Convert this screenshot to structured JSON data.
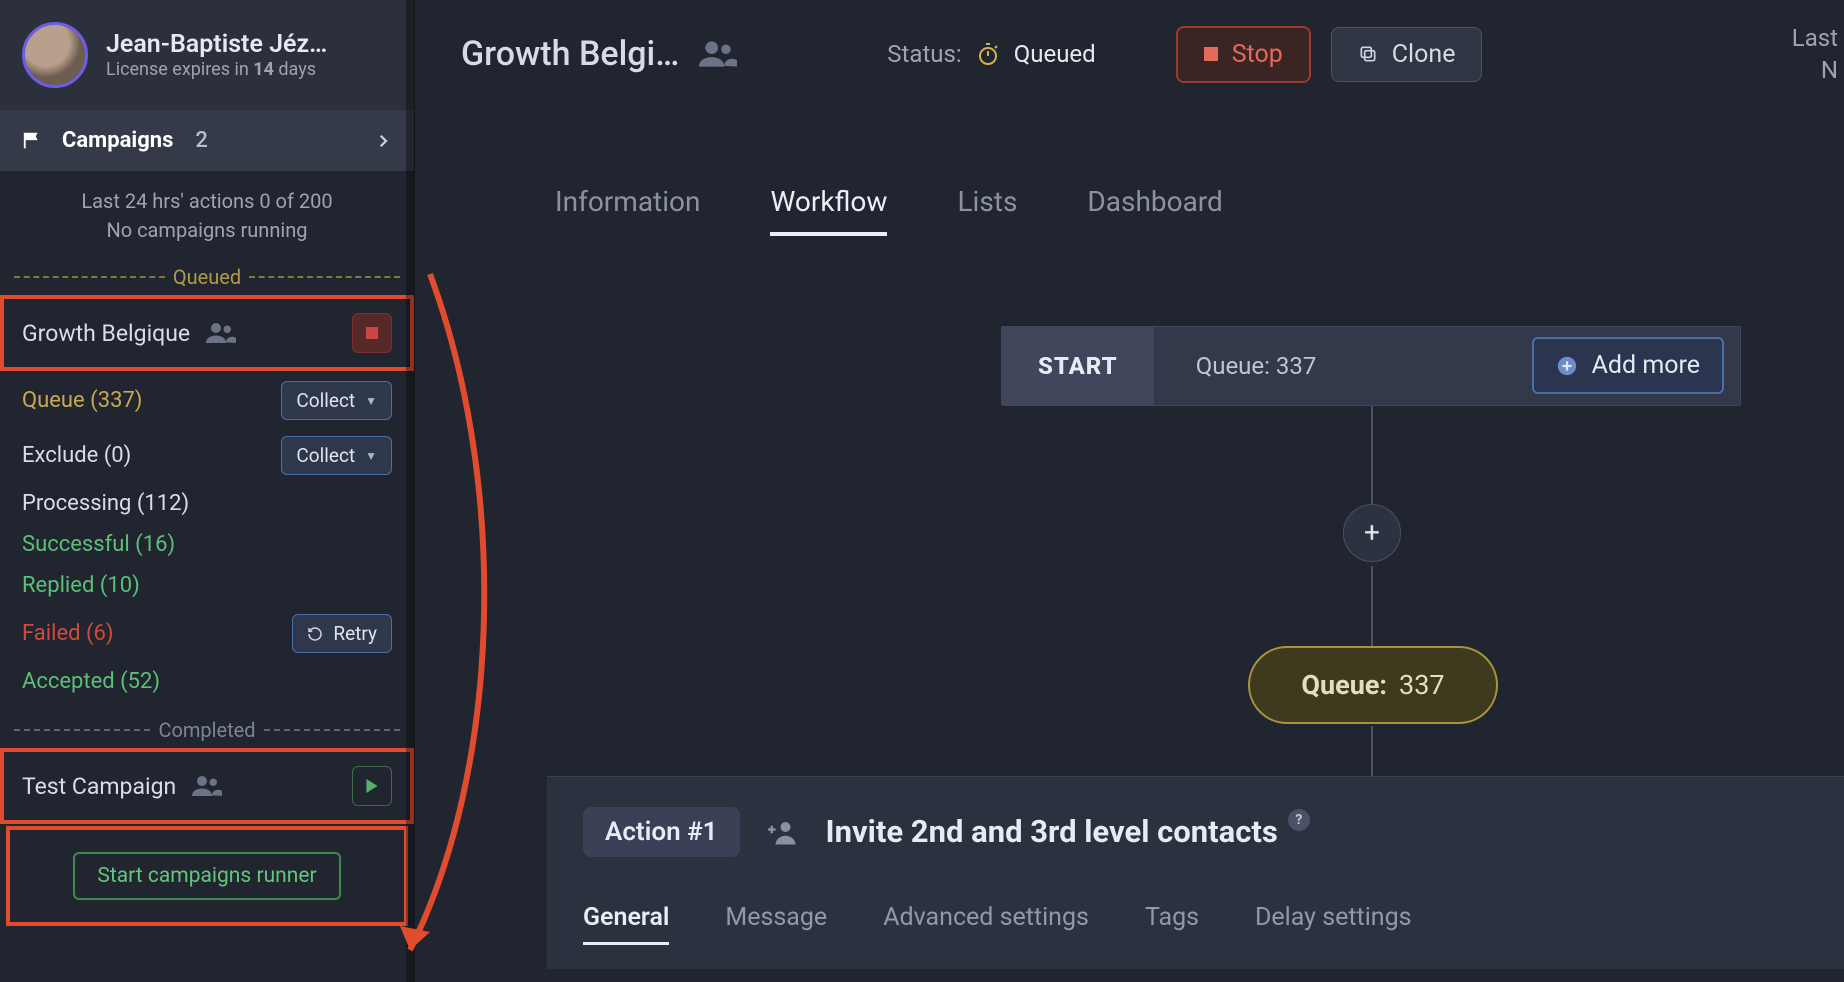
{
  "sidebar": {
    "profile": {
      "name": "Jean-Baptiste Jéz…",
      "license_prefix": "License expires in ",
      "license_days": "14",
      "license_suffix": " days"
    },
    "nav": {
      "campaigns_label": "Campaigns",
      "campaigns_count": "2"
    },
    "info": {
      "line1": "Last 24 hrs' actions 0 of 200",
      "line2": "No campaigns running"
    },
    "separators": {
      "queued": "Queued",
      "completed": "Completed"
    },
    "campaign_queued": {
      "name": "Growth Belgique"
    },
    "stats": {
      "queue": {
        "label": "Queue (337)",
        "action": "Collect"
      },
      "exclude": {
        "label": "Exclude (0)",
        "action": "Collect"
      },
      "processing": {
        "label": "Processing (112)"
      },
      "successful": {
        "label": "Successful (16)"
      },
      "replied": {
        "label": "Replied (10)"
      },
      "failed": {
        "label": "Failed (6)",
        "action": "Retry"
      },
      "accepted": {
        "label": "Accepted (52)"
      }
    },
    "campaign_completed": {
      "name": "Test Campaign"
    },
    "start_runner_label": "Start campaigns runner"
  },
  "main": {
    "title": "Growth Belgi…",
    "status_label": "Status:",
    "status_value": "Queued",
    "stop_label": "Stop",
    "clone_label": "Clone",
    "last_stamp_line1": "Last",
    "last_stamp_line2": "N",
    "tabs": {
      "information": "Information",
      "workflow": "Workflow",
      "lists": "Lists",
      "dashboard": "Dashboard"
    },
    "start_bar": {
      "start": "START",
      "queue_label": "Queue: 337",
      "addmore": "Add more"
    },
    "queue_pill": {
      "key": "Queue:",
      "value": "337"
    },
    "action": {
      "badge": "Action #1",
      "title": "Invite 2nd and 3rd level contacts",
      "tabs": {
        "general": "General",
        "message": "Message",
        "advanced": "Advanced settings",
        "tags": "Tags",
        "delay": "Delay settings"
      }
    }
  }
}
